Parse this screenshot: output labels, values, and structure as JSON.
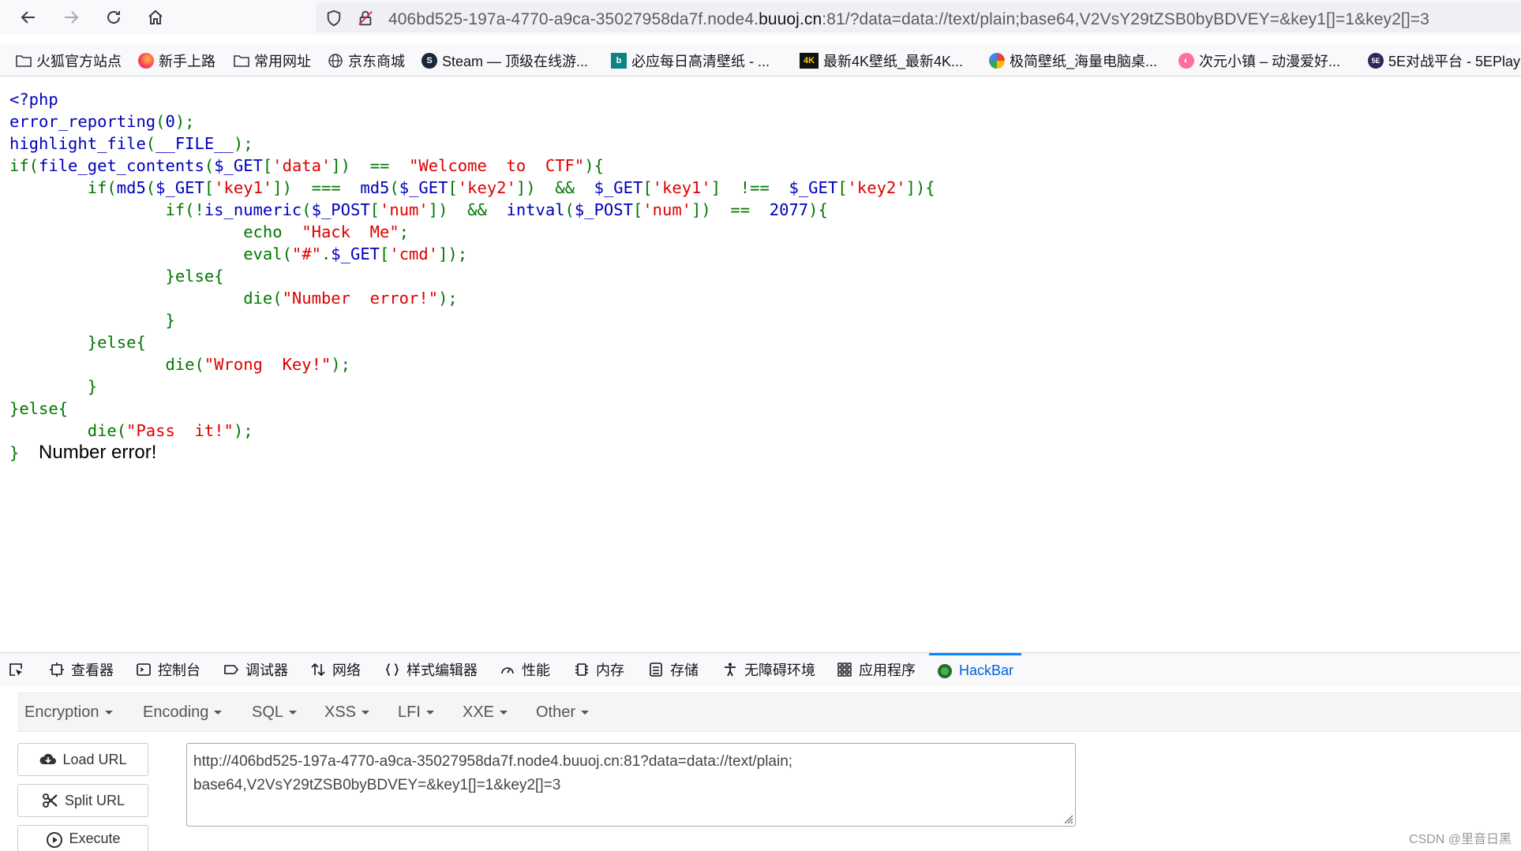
{
  "browser": {
    "url_prefix": "406bd525-197a-4770-a9ca-35027958da7f.node4.",
    "url_host": "buuoj.cn",
    "url_suffix": ":81/?data=data://text/plain;base64,V2VsY29tZSB0byBDVEY=&key1[]=1&key2[]=3"
  },
  "bookmarks": [
    {
      "label": "火狐官方站点",
      "icon": "folder-icon"
    },
    {
      "label": "新手上路",
      "icon": "firefox-icon"
    },
    {
      "label": "常用网址",
      "icon": "folder-icon"
    },
    {
      "label": "京东商城",
      "icon": "globe-icon"
    },
    {
      "label": "Steam — 顶级在线游...",
      "icon": "steam-icon"
    },
    {
      "label": "必应每日高清壁纸 - ...",
      "icon": "bing-icon"
    },
    {
      "label": "最新4K壁纸_最新4K...",
      "icon": "4k-icon"
    },
    {
      "label": "极简壁纸_海量电脑桌...",
      "icon": "pinwheel-icon"
    },
    {
      "label": "次元小镇 – 动漫爱好...",
      "icon": "anime-icon"
    },
    {
      "label": "5E对战平台 - 5EPlay",
      "icon": "5e-icon"
    }
  ],
  "code": {
    "l1": "<?php",
    "l2a": "error_reporting",
    "l2b": "(",
    "l2c": "0",
    "l2d": ");",
    "l3a": "highlight_file",
    "l3b": "(",
    "l3c": "__FILE__",
    "l3d": ");",
    "l4a": "if(",
    "l4b": "file_get_contents",
    "l4c": "(",
    "l4d": "$_GET",
    "l4e": "[",
    "l4f": "'data'",
    "l4g": "])  ==  ",
    "l4h": "\"Welcome  to  CTF\"",
    "l4i": "){",
    "l5a": "        if(",
    "l5b": "md5",
    "l5c": "(",
    "l5d": "$_GET",
    "l5e": "[",
    "l5f": "'key1'",
    "l5g": "])  ===  ",
    "l5h": "md5",
    "l5i": "(",
    "l5j": "$_GET",
    "l5k": "[",
    "l5l": "'key2'",
    "l5m": "])  &&  ",
    "l5n": "$_GET",
    "l5o": "[",
    "l5p": "'key1'",
    "l5q": "]  !==  ",
    "l5r": "$_GET",
    "l5s": "[",
    "l5t": "'key2'",
    "l5u": "]){",
    "l6a": "                if(!",
    "l6b": "is_numeric",
    "l6c": "(",
    "l6d": "$_POST",
    "l6e": "[",
    "l6f": "'num'",
    "l6g": "])  &&  ",
    "l6h": "intval",
    "l6i": "(",
    "l6j": "$_POST",
    "l6k": "[",
    "l6l": "'num'",
    "l6m": "])  ==  ",
    "l6n": "2077",
    "l6o": "){",
    "l7a": "                        echo  ",
    "l7b": "\"Hack  Me\"",
    "l7c": ";",
    "l8a": "                        eval(",
    "l8b": "\"#\"",
    "l8c": ".",
    "l8d": "$_GET",
    "l8e": "[",
    "l8f": "'cmd'",
    "l8g": "]);",
    "l9": "                }else{",
    "l10a": "                        die(",
    "l10b": "\"Number  error!\"",
    "l10c": ");",
    "l11": "                }",
    "l12": "        }else{",
    "l13a": "                die(",
    "l13b": "\"Wrong  Key!\"",
    "l13c": ");",
    "l14": "        }",
    "l15": "}else{",
    "l16a": "        die(",
    "l16b": "\"Pass  it!\"",
    "l16c": ");",
    "l17": "}",
    "output": "Number error!"
  },
  "devtools": {
    "tabs": [
      {
        "label": "查看器",
        "icon": "inspector-icon"
      },
      {
        "label": "控制台",
        "icon": "console-icon"
      },
      {
        "label": "调试器",
        "icon": "debugger-icon"
      },
      {
        "label": "网络",
        "icon": "network-icon"
      },
      {
        "label": "样式编辑器",
        "icon": "style-editor-icon"
      },
      {
        "label": "性能",
        "icon": "performance-icon"
      },
      {
        "label": "内存",
        "icon": "memory-icon"
      },
      {
        "label": "存储",
        "icon": "storage-icon"
      },
      {
        "label": "无障碍环境",
        "icon": "accessibility-icon"
      },
      {
        "label": "应用程序",
        "icon": "application-icon"
      },
      {
        "label": "HackBar",
        "icon": "hackbar-icon",
        "active": true
      }
    ]
  },
  "hackbar": {
    "menu": [
      "Encryption",
      "Encoding",
      "SQL",
      "XSS",
      "LFI",
      "XXE",
      "Other"
    ],
    "buttons": {
      "load": "Load URL",
      "split": "Split URL",
      "execute": "Execute"
    },
    "url_line1": "http://406bd525-197a-4770-a9ca-35027958da7f.node4.buuoj.cn:81?data=data://text/plain;",
    "url_line2": "base64,V2VsY29tZSB0byBDVEY=&key1[]=1&key2[]=3"
  },
  "watermark": "CSDN @里音日黑",
  "colors": {
    "accent": "#0060df",
    "php_keyword": "#007700",
    "php_string": "#dd0000",
    "php_default": "#0000bb"
  }
}
